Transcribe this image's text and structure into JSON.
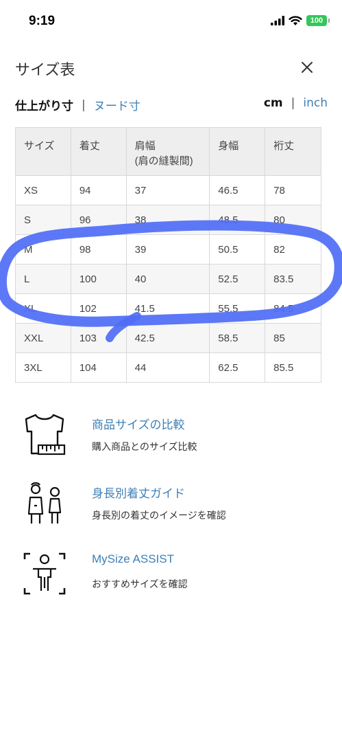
{
  "status": {
    "time": "9:19",
    "battery": "100"
  },
  "header": {
    "title": "サイズ表"
  },
  "toggles": {
    "measure_selected": "仕上がり寸",
    "measure_other": "ヌード寸",
    "unit_selected": "cm",
    "unit_other": "inch"
  },
  "table": {
    "headers": [
      "サイズ",
      "着丈",
      "肩幅",
      "(肩の縫製間)",
      "身幅",
      "裄丈"
    ],
    "rows": [
      [
        "XS",
        "94",
        "37",
        "46.5",
        "78"
      ],
      [
        "S",
        "96",
        "38",
        "48.5",
        "80"
      ],
      [
        "M",
        "98",
        "39",
        "50.5",
        "82"
      ],
      [
        "L",
        "100",
        "40",
        "52.5",
        "83.5"
      ],
      [
        "XL",
        "102",
        "41.5",
        "55.5",
        "84.5"
      ],
      [
        "XXL",
        "103",
        "42.5",
        "58.5",
        "85"
      ],
      [
        "3XL",
        "104",
        "44",
        "62.5",
        "85.5"
      ]
    ]
  },
  "links": [
    {
      "title": "商品サイズの比較",
      "subtitle": "購入商品とのサイズ比較",
      "icon": "tshirt-ruler-icon"
    },
    {
      "title": "身長別着丈ガイド",
      "subtitle": "身長別の着丈のイメージを確認",
      "icon": "people-height-icon"
    },
    {
      "title": "MySize ASSIST",
      "subtitle": "おすすめサイズを確認",
      "icon": "body-scan-icon"
    }
  ],
  "colors": {
    "link": "#3e7fb5",
    "marker": "#4f6df5",
    "battery": "#34c759"
  }
}
